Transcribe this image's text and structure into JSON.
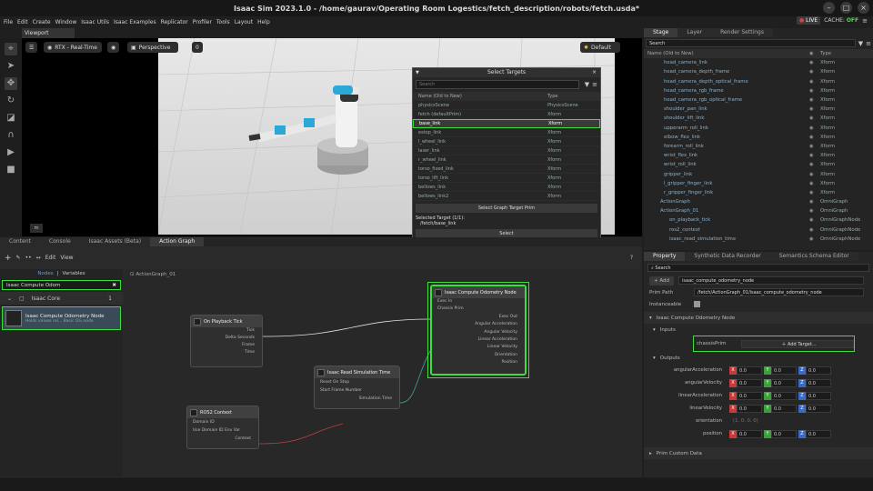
{
  "title": "Isaac Sim 2023.1.0 - /home/gaurav/Operating Room Logestics/fetch_description/robots/fetch.usda*",
  "menu": [
    "File",
    "Edit",
    "Create",
    "Window",
    "Isaac Utils",
    "Isaac Examples",
    "Replicator",
    "Profiler",
    "Tools",
    "Layout",
    "Help"
  ],
  "status": {
    "live": "LIVE",
    "cache_label": "CACHE:",
    "cache_value": "OFF"
  },
  "viewport": {
    "tab": "Viewport",
    "renderer": "RTX - Real-Time",
    "camera": "Perspective",
    "counter": "0",
    "lighting": "Default",
    "unit": "m"
  },
  "select_targets": {
    "title": "Select Targets",
    "search": "Search",
    "col_name": "Name (Old to New)",
    "col_type": "Type",
    "rows": [
      {
        "name": "physicsScene",
        "type": "PhysicsScene"
      },
      {
        "name": "fetch (defaultPrim)",
        "type": "Xform"
      },
      {
        "name": "base_link",
        "type": "Xform"
      },
      {
        "name": "estop_link",
        "type": "Xform"
      },
      {
        "name": "l_wheel_link",
        "type": "Xform"
      },
      {
        "name": "laser_link",
        "type": "Xform"
      },
      {
        "name": "r_wheel_link",
        "type": "Xform"
      },
      {
        "name": "torso_fixed_link",
        "type": "Xform"
      },
      {
        "name": "torso_lift_link",
        "type": "Xform"
      },
      {
        "name": "bellows_link",
        "type": "Xform"
      },
      {
        "name": "bellows_link2",
        "type": "Xform"
      }
    ],
    "graph_target_btn": "Select Graph Target Prim",
    "selected_label": "Selected Target (1/1):",
    "selected_value": "/fetch/base_link",
    "select_btn": "Select"
  },
  "stage": {
    "tabs": [
      "Stage",
      "Layer",
      "Render Settings"
    ],
    "search": "Search",
    "col_name": "Name (Old to New)",
    "col_type": "Type",
    "rows": [
      {
        "name": "head_camera_link",
        "type": "Xform"
      },
      {
        "name": "head_camera_depth_frame",
        "type": "Xform"
      },
      {
        "name": "head_camera_depth_optical_frame",
        "type": "Xform"
      },
      {
        "name": "head_camera_rgb_frame",
        "type": "Xform"
      },
      {
        "name": "head_camera_rgb_optical_frame",
        "type": "Xform"
      },
      {
        "name": "shoulder_pan_link",
        "type": "Xform"
      },
      {
        "name": "shoulder_lift_link",
        "type": "Xform"
      },
      {
        "name": "upperarm_roll_link",
        "type": "Xform"
      },
      {
        "name": "elbow_flex_link",
        "type": "Xform"
      },
      {
        "name": "forearm_roll_link",
        "type": "Xform"
      },
      {
        "name": "wrist_flex_link",
        "type": "Xform"
      },
      {
        "name": "wrist_roll_link",
        "type": "Xform"
      },
      {
        "name": "gripper_link",
        "type": "Xform"
      },
      {
        "name": "l_gripper_finger_link",
        "type": "Xform"
      },
      {
        "name": "r_gripper_finger_link",
        "type": "Xform"
      },
      {
        "name": "ActionGraph",
        "type": "OmniGraph"
      },
      {
        "name": "ActionGraph_01",
        "type": "OmniGraph"
      },
      {
        "name": "on_playback_tick",
        "type": "OmniGraphNode"
      },
      {
        "name": "ros2_context",
        "type": "OmniGraphNode"
      },
      {
        "name": "isaac_read_simulation_time",
        "type": "OmniGraphNode"
      }
    ]
  },
  "bottom_tabs": [
    "Content",
    "Console",
    "Isaac Assets (Beta)",
    "Action Graph"
  ],
  "graph": {
    "edit": "Edit",
    "view": "View",
    "nodes_label": "Nodes",
    "variables_label": "Variables",
    "search_value": "Isaac Compute Odom",
    "category": "Isaac Core",
    "category_count": "1",
    "result_title": "Isaac Compute Odometry Node",
    "result_desc": "Holds values rel... Basic OG node",
    "breadcrumb": "ActionGraph_01",
    "help": "?",
    "nodes": {
      "playback": {
        "title": "On Playback Tick",
        "pins": [
          "Tick",
          "Delta Seconds",
          "Frame",
          "Time"
        ]
      },
      "ros2": {
        "title": "ROS2 Context",
        "pins": [
          "Domain ID",
          "Use Domain ID Env Var",
          "Context"
        ]
      },
      "simtime": {
        "title": "Isaac Read Simulation Time",
        "pins": [
          "Reset On Stop",
          "Start Frame Number",
          "Simulation Time"
        ]
      },
      "odom": {
        "title": "Isaac Compute Odometry Node",
        "pins": [
          "Exec In",
          "Chassis Prim",
          "Exec Out",
          "Angular Acceleration",
          "Angular Velocity",
          "Linear Acceleration",
          "Linear Velocity",
          "Orientation",
          "Position"
        ]
      }
    }
  },
  "property": {
    "tabs": [
      "Property",
      "Synthetic Data Recorder",
      "Semantics Schema Editor"
    ],
    "search": "Search",
    "add": "Add",
    "node_name": "isaac_compute_odometry_node",
    "prim_path_label": "Prim Path",
    "prim_path": "/fetch/ActionGraph_01/isaac_compute_odometry_node",
    "instanceable_label": "Instanceable",
    "section": "Isaac Compute Odometry Node",
    "inputs": "Inputs",
    "chassis_label": "chassisPrim",
    "add_target": "Add Target...",
    "outputs": "Outputs",
    "vectors": [
      {
        "label": "angularAcceleration",
        "x": "0.0",
        "y": "0.0",
        "z": "0.0"
      },
      {
        "label": "angularVelocity",
        "x": "0.0",
        "y": "0.0",
        "z": "0.0"
      },
      {
        "label": "linearAcceleration",
        "x": "0.0",
        "y": "0.0",
        "z": "0.0"
      },
      {
        "label": "linearVelocity",
        "x": "0.0",
        "y": "0.0",
        "z": "0.0"
      }
    ],
    "orientation_label": "orientation",
    "orientation_value": "(1, 0, 0, 0)",
    "position_label": "position",
    "position": {
      "x": "0.0",
      "y": "0.0",
      "z": "0.0"
    },
    "custom_data": "Prim Custom Data"
  },
  "colors": {
    "highlight": "#3ae03a",
    "x": "#c83a3a",
    "y": "#3aa03a",
    "z": "#3a6ac8"
  }
}
